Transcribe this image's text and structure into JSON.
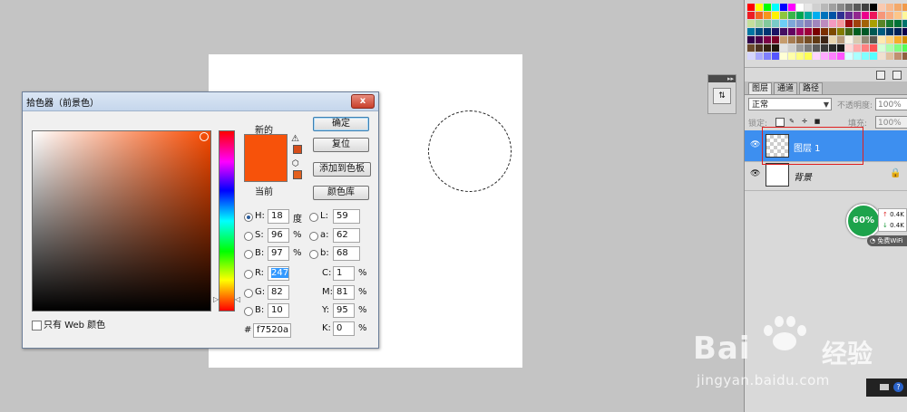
{
  "dialog": {
    "title": "拾色器（前景色）",
    "close_glyph": "x",
    "new_label": "新的",
    "current_label": "当前",
    "new_color": "#f7520a",
    "current_color": "#f7520a",
    "buttons": {
      "ok": "确定",
      "reset": "复位",
      "add_swatch": "添加到色板",
      "color_libraries": "颜色库"
    },
    "web_only_label": "只有 Web 颜色",
    "hsb": {
      "h": {
        "label": "H:",
        "value": "18",
        "unit": "度"
      },
      "s": {
        "label": "S:",
        "value": "96",
        "unit": "%"
      },
      "b": {
        "label": "B:",
        "value": "97",
        "unit": "%"
      }
    },
    "lab": {
      "l": {
        "label": "L:",
        "value": "59"
      },
      "a": {
        "label": "a:",
        "value": "62"
      },
      "b": {
        "label": "b:",
        "value": "68"
      }
    },
    "rgb": {
      "r": {
        "label": "R:",
        "value": "247"
      },
      "g": {
        "label": "G:",
        "value": "82"
      },
      "b": {
        "label": "B:",
        "value": "10"
      }
    },
    "cmyk": {
      "c": {
        "label": "C:",
        "value": "1",
        "unit": "%"
      },
      "m": {
        "label": "M:",
        "value": "81",
        "unit": "%"
      },
      "y": {
        "label": "Y:",
        "value": "95",
        "unit": "%"
      },
      "k": {
        "label": "K:",
        "value": "0",
        "unit": "%"
      }
    },
    "hex": {
      "label": "#",
      "value": "f7520a"
    }
  },
  "layers_panel": {
    "tabs": [
      "图层",
      "通道",
      "路径"
    ],
    "blend_mode": "正常",
    "opacity_label": "不透明度:",
    "opacity_value": "100%",
    "lock_label": "锁定:",
    "fill_label": "填充:",
    "fill_value": "100%",
    "layers": [
      {
        "name": "图层 1",
        "selected": true
      },
      {
        "name": "背景",
        "selected": false
      }
    ]
  },
  "wifi_widget": {
    "percent": "60%",
    "upload": "0.4K",
    "download": "0.4K",
    "tag": "免费WiFi"
  },
  "watermark": {
    "brand": "Bai",
    "brand2": "经验",
    "url": "jingyan.baidu.com"
  },
  "colors": {
    "accent_selection": "#3d8ff0",
    "highlight_box": "#e02020"
  }
}
